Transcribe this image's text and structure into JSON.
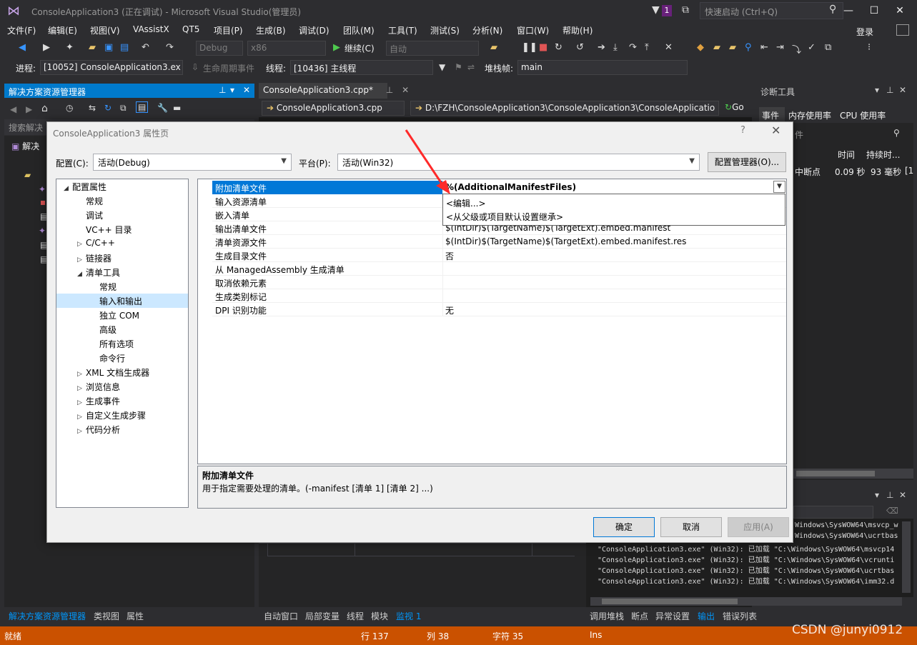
{
  "window": {
    "title": "ConsoleApplication3 (正在调试) - Microsoft Visual Studio(管理员)",
    "notification_count": "1",
    "quick_launch_placeholder": "快速启动 (Ctrl+Q)",
    "login": "登录"
  },
  "menu": [
    "文件(F)",
    "编辑(E)",
    "视图(V)",
    "VAssistX",
    "QT5",
    "项目(P)",
    "生成(B)",
    "调试(D)",
    "团队(M)",
    "工具(T)",
    "测试(S)",
    "分析(N)",
    "窗口(W)",
    "帮助(H)"
  ],
  "toolbar": {
    "config": "Debug",
    "platform": "x86",
    "continue": "继续(C)",
    "auto": "自动"
  },
  "debug_bar": {
    "process_label": "进程:",
    "process_value": "[10052] ConsoleApplication3.ex",
    "lifecycle_label": "生命周期事件",
    "thread_label": "线程:",
    "thread_value": "[10436] 主线程",
    "stackframe_label": "堆栈帧:",
    "stackframe_value": "main"
  },
  "solution_explorer": {
    "title": "解决方案资源管理器",
    "search_placeholder": "搜索解决",
    "root": "解决"
  },
  "editor": {
    "tab": "ConsoleApplication3.cpp*",
    "nav_file": "ConsoleApplication3.cpp",
    "nav_path": "D:\\FZH\\ConsoleApplication3\\ConsoleApplication3\\ConsoleApplicatio",
    "go": "Go"
  },
  "diagnostics": {
    "title": "诊断工具",
    "tabs": [
      "事件",
      "内存使用率",
      "CPU 使用率"
    ],
    "search": "件",
    "col_time": "时间",
    "col_duration": "持续时...",
    "row_event": "中断点",
    "row_time": "0.09 秒",
    "row_duration": "93 毫秒",
    "row_extra": "[1"
  },
  "output": {
    "lines": [
      "Windows\\SysWOW64\\msvcp_w",
      "Windows\\SysWOW64\\ucrtbas",
      "\"ConsoleApplication3.exe\" (Win32): 已加载 \"C:\\Windows\\SysWOW64\\msvcp14",
      "\"ConsoleApplication3.exe\" (Win32): 已加载 \"C:\\Windows\\SysWOW64\\vcrunti",
      "\"ConsoleApplication3.exe\" (Win32): 已加载 \"C:\\Windows\\SysWOW64\\ucrtbas",
      "\"ConsoleApplication3.exe\" (Win32): 已加载 \"C:\\Windows\\SysWOW64\\imm32.d"
    ]
  },
  "bottom_tabs_left": [
    "解决方案资源管理器",
    "类视图",
    "属性"
  ],
  "bottom_tabs_mid": [
    "自动窗口",
    "局部变量",
    "线程",
    "模块",
    "监视 1"
  ],
  "bottom_tabs_right": [
    "调用堆栈",
    "断点",
    "异常设置",
    "输出",
    "错误列表"
  ],
  "status": {
    "ready": "就绪",
    "line": "行 137",
    "col": "列 38",
    "char": "字符 35",
    "ins": "Ins"
  },
  "watermark": "CSDN @junyi0912",
  "dialog": {
    "title": "ConsoleApplication3 属性页",
    "help": "?",
    "config_label": "配置(C):",
    "config_value": "活动(Debug)",
    "platform_label": "平台(P):",
    "platform_value": "活动(Win32)",
    "config_manager": "配置管理器(O)...",
    "tree": [
      {
        "label": "配置属性",
        "expander": "◢",
        "indent": 0
      },
      {
        "label": "常规",
        "expander": "",
        "indent": 1
      },
      {
        "label": "调试",
        "expander": "",
        "indent": 1
      },
      {
        "label": "VC++ 目录",
        "expander": "",
        "indent": 1
      },
      {
        "label": "C/C++",
        "expander": "▷",
        "indent": 1
      },
      {
        "label": "链接器",
        "expander": "▷",
        "indent": 1
      },
      {
        "label": "清单工具",
        "expander": "◢",
        "indent": 1
      },
      {
        "label": "常规",
        "expander": "",
        "indent": 2
      },
      {
        "label": "输入和输出",
        "expander": "",
        "indent": 2,
        "selected": true
      },
      {
        "label": "独立 COM",
        "expander": "",
        "indent": 2
      },
      {
        "label": "高级",
        "expander": "",
        "indent": 2
      },
      {
        "label": "所有选项",
        "expander": "",
        "indent": 2
      },
      {
        "label": "命令行",
        "expander": "",
        "indent": 2
      },
      {
        "label": "XML 文档生成器",
        "expander": "▷",
        "indent": 1
      },
      {
        "label": "浏览信息",
        "expander": "▷",
        "indent": 1
      },
      {
        "label": "生成事件",
        "expander": "▷",
        "indent": 1
      },
      {
        "label": "自定义生成步骤",
        "expander": "▷",
        "indent": 1
      },
      {
        "label": "代码分析",
        "expander": "▷",
        "indent": 1
      }
    ],
    "properties": [
      {
        "name": "附加清单文件",
        "value": "%(AdditionalManifestFiles)",
        "selected": true
      },
      {
        "name": "输入资源清单",
        "value": ""
      },
      {
        "name": "嵌入清单",
        "value": ""
      },
      {
        "name": "输出清单文件",
        "value": "$(IntDir)$(TargetName)$(TargetExt).embed.manifest"
      },
      {
        "name": "清单资源文件",
        "value": "$(IntDir)$(TargetName)$(TargetExt).embed.manifest.res"
      },
      {
        "name": "生成目录文件",
        "value": "否"
      },
      {
        "name": "从 ManagedAssembly 生成清单",
        "value": ""
      },
      {
        "name": "取消依赖元素",
        "value": ""
      },
      {
        "name": "生成类别标记",
        "value": ""
      },
      {
        "name": "DPI 识别功能",
        "value": "无"
      }
    ],
    "dropdown_options": [
      "<编辑...>",
      "<从父级或项目默认设置继承>"
    ],
    "description_title": "附加清单文件",
    "description_text": "用于指定需要处理的清单。(-manifest [清单 1] [清单 2] ...)",
    "ok": "确定",
    "cancel": "取消",
    "apply": "应用(A)"
  },
  "colors": {
    "accent": "#007acc",
    "status_bar": "#ca5100",
    "selection": "#0078d7",
    "annotation_arrow": "#ff2a2a"
  }
}
